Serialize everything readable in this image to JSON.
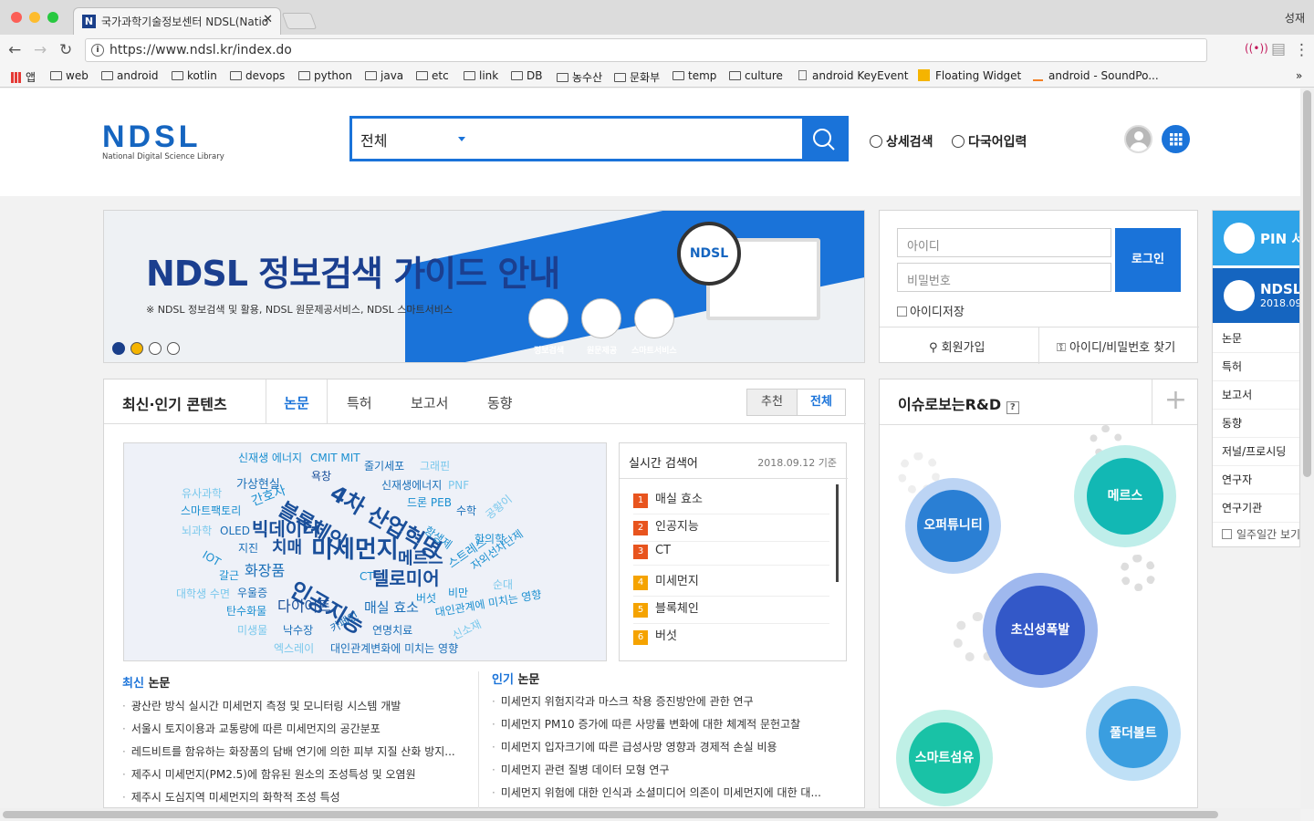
{
  "browser": {
    "tab_title": "국가과학기술정보센터 NDSL(Natio",
    "profile": "성재",
    "url": "https://www.ndsl.kr/index.do",
    "bookmarks": [
      "앱",
      "web",
      "android",
      "kotlin",
      "devops",
      "python",
      "java",
      "etc",
      "link",
      "DB",
      "농수산",
      "문화부",
      "temp",
      "culture",
      "android KeyEvent",
      "Floating Widget",
      "android - SoundPo...",
      "»"
    ]
  },
  "header": {
    "logo": "NDSL",
    "logo_sub": "National Digital Science Library",
    "search_scope": "전체",
    "detail_search": "상세검색",
    "multilang": "다국어입력"
  },
  "banner": {
    "title": "NDSL 정보검색 가이드 안내",
    "desc": "※ NDSL 정보검색 및 활용, NDSL 원문제공서비스, NDSL 스마트서비스",
    "icons": [
      "정보검색",
      "원문제공",
      "스마트서비스"
    ]
  },
  "login": {
    "id_placeholder": "아이디",
    "pw_placeholder": "비밀번호",
    "login": "로그인",
    "save_id": "아이디저장",
    "join": "회원가입",
    "find": "아이디/비밀번호 찾기"
  },
  "contents": {
    "title": "최신·인기 콘텐츠",
    "tabs": [
      "논문",
      "특허",
      "보고서",
      "동향"
    ],
    "recommend": "추천",
    "all": "전체",
    "realtime_title": "실시간 검색어",
    "realtime_date": "2018.09.12 기준",
    "realtime": [
      "매실 효소",
      "인공지능",
      "CT",
      "미세먼지",
      "블록체인",
      "버섯"
    ],
    "latest_title_a": "최신",
    "latest_title_b": " 논문",
    "latest": [
      "광산란 방식 실시간 미세먼지 측정 및 모니터링 시스템 개발",
      "서울시 토지이용과 교통량에 따른 미세먼지의 공간분포",
      "레드비트를 함유하는 화장품의 담배 연기에 의한 피부 지질 산화 방지...",
      "제주시 미세먼지(PM2.5)에 함유된 원소의 조성특성 및 오염원",
      "제주시 도심지역 미세먼지의 화학적 조성 특성"
    ],
    "popular_title_a": "인기",
    "popular_title_b": " 논문",
    "popular": [
      "미세먼지 위험지각과 마스크 착용 증진방안에 관한 연구",
      "미세먼지 PM10 증가에 따른 사망률 변화에 대한 체계적 문헌고찰",
      "미세먼지 입자크기에 따른 급성사망 영향과 경제적 손실 비용",
      "미세먼지 관련 질병 데이터 모형 연구",
      "미세먼지 위험에 대한 인식과 소셜미디어 의존이 미세먼지에 대한 대..."
    ]
  },
  "cloud": [
    {
      "t": "신재생 에너지",
      "c": "#1a8fd0",
      "s": 12
    },
    {
      "t": "CMIT MIT",
      "c": "#1a8fd0",
      "s": 12
    },
    {
      "t": "줄기세포",
      "c": "#1a6fb8",
      "s": 12
    },
    {
      "t": "그래핀",
      "c": "#7ac8ec",
      "s": 12
    },
    {
      "t": "욕창",
      "c": "#1a4f9a",
      "s": 12
    },
    {
      "t": "4차 산업혁명",
      "c": "#1a4f9a",
      "s": 24
    },
    {
      "t": "신재생에너지",
      "c": "#1a6fb8",
      "s": 12
    },
    {
      "t": "PNF",
      "c": "#7ac8ec",
      "s": 12
    },
    {
      "t": "유사과학",
      "c": "#7ac8ec",
      "s": 12
    },
    {
      "t": "가상현실",
      "c": "#1a6fb8",
      "s": 13
    },
    {
      "t": "블록체인",
      "c": "#1a4f9a",
      "s": 22
    },
    {
      "t": "드론 PEB",
      "c": "#1a8fd0",
      "s": 12
    },
    {
      "t": "스마트팩토리",
      "c": "#1a8fd0",
      "s": 12
    },
    {
      "t": "간호사",
      "c": "#1a8fd0",
      "s": 14
    },
    {
      "t": "수학",
      "c": "#1a6fb8",
      "s": 12
    },
    {
      "t": "공황이",
      "c": "#7ac8ec",
      "s": 12
    },
    {
      "t": "뇌과학",
      "c": "#7ac8ec",
      "s": 12
    },
    {
      "t": "OLED",
      "c": "#1a6fb8",
      "s": 12
    },
    {
      "t": "빅데이터",
      "c": "#1a4f9a",
      "s": 20
    },
    {
      "t": "항생제",
      "c": "#1a8fd0",
      "s": 12
    },
    {
      "t": "한의학",
      "c": "#1a8fd0",
      "s": 12
    },
    {
      "t": "IOT",
      "c": "#1a8fd0",
      "s": 12
    },
    {
      "t": "지진",
      "c": "#1a6fb8",
      "s": 12
    },
    {
      "t": "치매",
      "c": "#1a4f9a",
      "s": 18
    },
    {
      "t": "미세먼지",
      "c": "#1a4f9a",
      "s": 26
    },
    {
      "t": "메르스",
      "c": "#1a4f9a",
      "s": 18
    },
    {
      "t": "스트레스",
      "c": "#1a8fd0",
      "s": 13
    },
    {
      "t": "자외선차단제",
      "c": "#1a8fd0",
      "s": 12
    },
    {
      "t": "갈근",
      "c": "#1a8fd0",
      "s": 12
    },
    {
      "t": "화장품",
      "c": "#1a6fb8",
      "s": 16
    },
    {
      "t": "인공지능",
      "c": "#1a4f9a",
      "s": 24
    },
    {
      "t": "CT",
      "c": "#1a8fd0",
      "s": 12
    },
    {
      "t": "텔로미어",
      "c": "#1a4f9a",
      "s": 20
    },
    {
      "t": "순대",
      "c": "#7ac8ec",
      "s": 12
    },
    {
      "t": "대학생 수면",
      "c": "#7ac8ec",
      "s": 12
    },
    {
      "t": "우울증",
      "c": "#1a6fb8",
      "s": 12
    },
    {
      "t": "비만",
      "c": "#1a8fd0",
      "s": 12
    },
    {
      "t": "다이어트",
      "c": "#1a4f9a",
      "s": 16
    },
    {
      "t": "매실 효소",
      "c": "#1a6fb8",
      "s": 15
    },
    {
      "t": "버섯",
      "c": "#1a8fd0",
      "s": 12
    },
    {
      "t": "대인관계에 미치는 영향",
      "c": "#1a8fd0",
      "s": 12
    },
    {
      "t": "탄수화물",
      "c": "#1a8fd0",
      "s": 12
    },
    {
      "t": "미생물",
      "c": "#7ac8ec",
      "s": 12
    },
    {
      "t": "낙수장",
      "c": "#1a6fb8",
      "s": 12
    },
    {
      "t": "카페인",
      "c": "#1a6fb8",
      "s": 12
    },
    {
      "t": "연명치료",
      "c": "#1a6fb8",
      "s": 12
    },
    {
      "t": "신소재",
      "c": "#7ac8ec",
      "s": 12
    },
    {
      "t": "엑스레이",
      "c": "#7ac8ec",
      "s": 12
    },
    {
      "t": "대인관계변화에 미치는 영향",
      "c": "#1a6fb8",
      "s": 12
    }
  ],
  "issue": {
    "title": "이슈로보는R&D",
    "help": "?",
    "bubbles": [
      "오퍼튜니티",
      "메르스",
      "초신성폭발",
      "풀더볼트",
      "스마트섬유"
    ]
  },
  "rightbar": {
    "pin": "PIN 서비",
    "ndsl": "NDSL",
    "ndsl_date": "2018.09",
    "items": [
      "논문",
      "특허",
      "보고서",
      "동향",
      "저널/프로시딩",
      "연구자",
      "연구기관"
    ],
    "week": "일주일간 보기"
  }
}
